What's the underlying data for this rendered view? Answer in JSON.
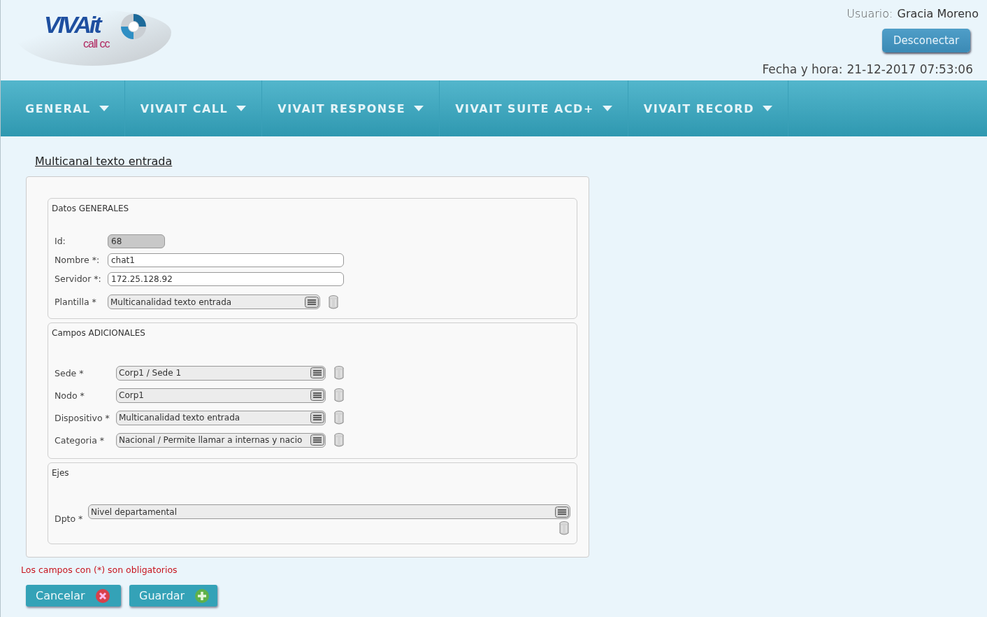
{
  "logo": {
    "brand": "VIVAit",
    "product": "call cc"
  },
  "user": {
    "label": "Usuario:",
    "name": "Gracia Moreno"
  },
  "disconnect_button": "Desconectar",
  "datetime": {
    "label": "Fecha y hora:",
    "value": "21-12-2017 07:53:06"
  },
  "nav": [
    {
      "label": "GENERAL"
    },
    {
      "label": "VIVAIT CALL"
    },
    {
      "label": "VIVAIT RESPONSE"
    },
    {
      "label": "VIVAIT SUITE ACD+"
    },
    {
      "label": "VIVAIT RECORD"
    }
  ],
  "page_title": "Multicanal texto entrada",
  "sections": [
    {
      "legend": "Datos GENERALES",
      "fields": [
        {
          "label": "Id:",
          "value": "68",
          "kind": "readonly"
        },
        {
          "label": "Nombre *:",
          "value": "chat1",
          "kind": "text"
        },
        {
          "label": "Servidor *:",
          "value": "172.25.128.92",
          "kind": "text"
        },
        {
          "label": "Plantilla *",
          "value": "Multicanalidad texto entrada",
          "kind": "select"
        }
      ]
    },
    {
      "legend": "Campos ADICIONALES",
      "fields": [
        {
          "label": "Sede *",
          "value": "Corp1 / Sede 1",
          "kind": "select"
        },
        {
          "label": "Nodo *",
          "value": "Corp1",
          "kind": "select"
        },
        {
          "label": "Dispositivo *",
          "value": "Multicanalidad texto entrada",
          "kind": "select"
        },
        {
          "label": "Categoria *",
          "value": "Nacional / Permite llamar a internas y nacio",
          "kind": "select"
        }
      ]
    },
    {
      "legend": "Ejes",
      "fields": [
        {
          "label": "Dpto *",
          "value": "Nivel departamental",
          "kind": "select_wide"
        }
      ]
    }
  ],
  "required_note": "Los campos con (*) son obligatorios",
  "buttons": [
    {
      "label": "Cancelar",
      "kind": "cancel"
    },
    {
      "label": "Guardar",
      "kind": "save"
    }
  ]
}
